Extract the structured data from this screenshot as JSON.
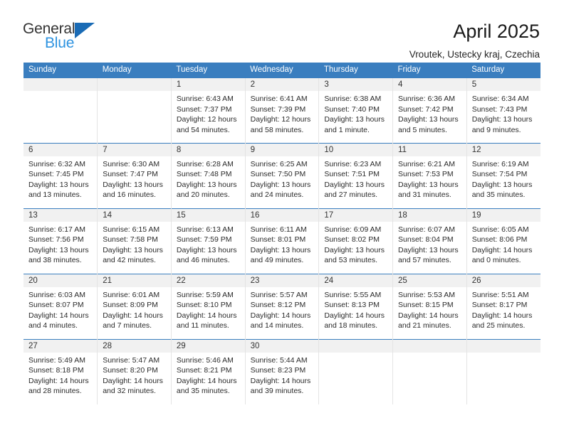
{
  "brand": {
    "name_part1": "General",
    "name_part2": "Blue",
    "triangle_icon": "blue-triangle-icon",
    "color_dark": "#333333",
    "color_blue": "#2e93e0"
  },
  "header": {
    "title": "April 2025",
    "subtitle": "Vroutek, Ustecky kraj, Czechia"
  },
  "calendar": {
    "header_bg": "#3a7ebf",
    "daynum_bg": "#f1f1f1",
    "weekday_headers": [
      "Sunday",
      "Monday",
      "Tuesday",
      "Wednesday",
      "Thursday",
      "Friday",
      "Saturday"
    ],
    "weeks": [
      [
        {
          "day": "",
          "blank": true,
          "sunrise": "",
          "sunset": "",
          "daylight_line1": "",
          "daylight_line2": ""
        },
        {
          "day": "",
          "blank": true,
          "sunrise": "",
          "sunset": "",
          "daylight_line1": "",
          "daylight_line2": ""
        },
        {
          "day": "1",
          "blank": false,
          "sunrise": "Sunrise: 6:43 AM",
          "sunset": "Sunset: 7:37 PM",
          "daylight_line1": "Daylight: 12 hours",
          "daylight_line2": "and 54 minutes."
        },
        {
          "day": "2",
          "blank": false,
          "sunrise": "Sunrise: 6:41 AM",
          "sunset": "Sunset: 7:39 PM",
          "daylight_line1": "Daylight: 12 hours",
          "daylight_line2": "and 58 minutes."
        },
        {
          "day": "3",
          "blank": false,
          "sunrise": "Sunrise: 6:38 AM",
          "sunset": "Sunset: 7:40 PM",
          "daylight_line1": "Daylight: 13 hours",
          "daylight_line2": "and 1 minute."
        },
        {
          "day": "4",
          "blank": false,
          "sunrise": "Sunrise: 6:36 AM",
          "sunset": "Sunset: 7:42 PM",
          "daylight_line1": "Daylight: 13 hours",
          "daylight_line2": "and 5 minutes."
        },
        {
          "day": "5",
          "blank": false,
          "sunrise": "Sunrise: 6:34 AM",
          "sunset": "Sunset: 7:43 PM",
          "daylight_line1": "Daylight: 13 hours",
          "daylight_line2": "and 9 minutes."
        }
      ],
      [
        {
          "day": "6",
          "blank": false,
          "sunrise": "Sunrise: 6:32 AM",
          "sunset": "Sunset: 7:45 PM",
          "daylight_line1": "Daylight: 13 hours",
          "daylight_line2": "and 13 minutes."
        },
        {
          "day": "7",
          "blank": false,
          "sunrise": "Sunrise: 6:30 AM",
          "sunset": "Sunset: 7:47 PM",
          "daylight_line1": "Daylight: 13 hours",
          "daylight_line2": "and 16 minutes."
        },
        {
          "day": "8",
          "blank": false,
          "sunrise": "Sunrise: 6:28 AM",
          "sunset": "Sunset: 7:48 PM",
          "daylight_line1": "Daylight: 13 hours",
          "daylight_line2": "and 20 minutes."
        },
        {
          "day": "9",
          "blank": false,
          "sunrise": "Sunrise: 6:25 AM",
          "sunset": "Sunset: 7:50 PM",
          "daylight_line1": "Daylight: 13 hours",
          "daylight_line2": "and 24 minutes."
        },
        {
          "day": "10",
          "blank": false,
          "sunrise": "Sunrise: 6:23 AM",
          "sunset": "Sunset: 7:51 PM",
          "daylight_line1": "Daylight: 13 hours",
          "daylight_line2": "and 27 minutes."
        },
        {
          "day": "11",
          "blank": false,
          "sunrise": "Sunrise: 6:21 AM",
          "sunset": "Sunset: 7:53 PM",
          "daylight_line1": "Daylight: 13 hours",
          "daylight_line2": "and 31 minutes."
        },
        {
          "day": "12",
          "blank": false,
          "sunrise": "Sunrise: 6:19 AM",
          "sunset": "Sunset: 7:54 PM",
          "daylight_line1": "Daylight: 13 hours",
          "daylight_line2": "and 35 minutes."
        }
      ],
      [
        {
          "day": "13",
          "blank": false,
          "sunrise": "Sunrise: 6:17 AM",
          "sunset": "Sunset: 7:56 PM",
          "daylight_line1": "Daylight: 13 hours",
          "daylight_line2": "and 38 minutes."
        },
        {
          "day": "14",
          "blank": false,
          "sunrise": "Sunrise: 6:15 AM",
          "sunset": "Sunset: 7:58 PM",
          "daylight_line1": "Daylight: 13 hours",
          "daylight_line2": "and 42 minutes."
        },
        {
          "day": "15",
          "blank": false,
          "sunrise": "Sunrise: 6:13 AM",
          "sunset": "Sunset: 7:59 PM",
          "daylight_line1": "Daylight: 13 hours",
          "daylight_line2": "and 46 minutes."
        },
        {
          "day": "16",
          "blank": false,
          "sunrise": "Sunrise: 6:11 AM",
          "sunset": "Sunset: 8:01 PM",
          "daylight_line1": "Daylight: 13 hours",
          "daylight_line2": "and 49 minutes."
        },
        {
          "day": "17",
          "blank": false,
          "sunrise": "Sunrise: 6:09 AM",
          "sunset": "Sunset: 8:02 PM",
          "daylight_line1": "Daylight: 13 hours",
          "daylight_line2": "and 53 minutes."
        },
        {
          "day": "18",
          "blank": false,
          "sunrise": "Sunrise: 6:07 AM",
          "sunset": "Sunset: 8:04 PM",
          "daylight_line1": "Daylight: 13 hours",
          "daylight_line2": "and 57 minutes."
        },
        {
          "day": "19",
          "blank": false,
          "sunrise": "Sunrise: 6:05 AM",
          "sunset": "Sunset: 8:06 PM",
          "daylight_line1": "Daylight: 14 hours",
          "daylight_line2": "and 0 minutes."
        }
      ],
      [
        {
          "day": "20",
          "blank": false,
          "sunrise": "Sunrise: 6:03 AM",
          "sunset": "Sunset: 8:07 PM",
          "daylight_line1": "Daylight: 14 hours",
          "daylight_line2": "and 4 minutes."
        },
        {
          "day": "21",
          "blank": false,
          "sunrise": "Sunrise: 6:01 AM",
          "sunset": "Sunset: 8:09 PM",
          "daylight_line1": "Daylight: 14 hours",
          "daylight_line2": "and 7 minutes."
        },
        {
          "day": "22",
          "blank": false,
          "sunrise": "Sunrise: 5:59 AM",
          "sunset": "Sunset: 8:10 PM",
          "daylight_line1": "Daylight: 14 hours",
          "daylight_line2": "and 11 minutes."
        },
        {
          "day": "23",
          "blank": false,
          "sunrise": "Sunrise: 5:57 AM",
          "sunset": "Sunset: 8:12 PM",
          "daylight_line1": "Daylight: 14 hours",
          "daylight_line2": "and 14 minutes."
        },
        {
          "day": "24",
          "blank": false,
          "sunrise": "Sunrise: 5:55 AM",
          "sunset": "Sunset: 8:13 PM",
          "daylight_line1": "Daylight: 14 hours",
          "daylight_line2": "and 18 minutes."
        },
        {
          "day": "25",
          "blank": false,
          "sunrise": "Sunrise: 5:53 AM",
          "sunset": "Sunset: 8:15 PM",
          "daylight_line1": "Daylight: 14 hours",
          "daylight_line2": "and 21 minutes."
        },
        {
          "day": "26",
          "blank": false,
          "sunrise": "Sunrise: 5:51 AM",
          "sunset": "Sunset: 8:17 PM",
          "daylight_line1": "Daylight: 14 hours",
          "daylight_line2": "and 25 minutes."
        }
      ],
      [
        {
          "day": "27",
          "blank": false,
          "sunrise": "Sunrise: 5:49 AM",
          "sunset": "Sunset: 8:18 PM",
          "daylight_line1": "Daylight: 14 hours",
          "daylight_line2": "and 28 minutes."
        },
        {
          "day": "28",
          "blank": false,
          "sunrise": "Sunrise: 5:47 AM",
          "sunset": "Sunset: 8:20 PM",
          "daylight_line1": "Daylight: 14 hours",
          "daylight_line2": "and 32 minutes."
        },
        {
          "day": "29",
          "blank": false,
          "sunrise": "Sunrise: 5:46 AM",
          "sunset": "Sunset: 8:21 PM",
          "daylight_line1": "Daylight: 14 hours",
          "daylight_line2": "and 35 minutes."
        },
        {
          "day": "30",
          "blank": false,
          "sunrise": "Sunrise: 5:44 AM",
          "sunset": "Sunset: 8:23 PM",
          "daylight_line1": "Daylight: 14 hours",
          "daylight_line2": "and 39 minutes."
        },
        {
          "day": "",
          "blank": true,
          "sunrise": "",
          "sunset": "",
          "daylight_line1": "",
          "daylight_line2": ""
        },
        {
          "day": "",
          "blank": true,
          "sunrise": "",
          "sunset": "",
          "daylight_line1": "",
          "daylight_line2": ""
        },
        {
          "day": "",
          "blank": true,
          "sunrise": "",
          "sunset": "",
          "daylight_line1": "",
          "daylight_line2": ""
        }
      ]
    ]
  }
}
